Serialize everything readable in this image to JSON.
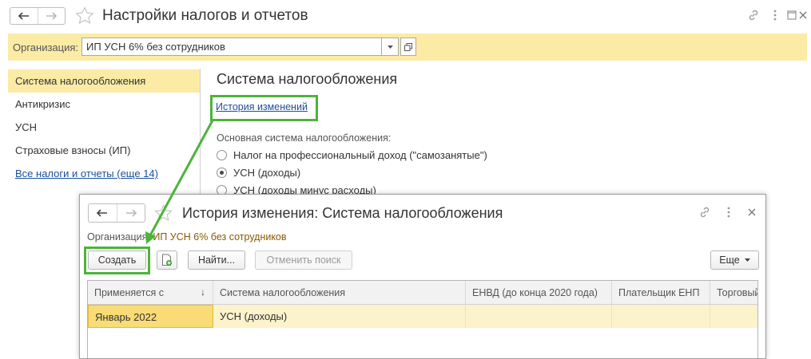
{
  "main_window": {
    "title": "Настройки налогов и отчетов",
    "organization_label": "Организация:",
    "organization_value": "ИП УСН 6% без сотрудников",
    "sidebar": [
      {
        "label": "Система налогообложения",
        "active": true,
        "link": false
      },
      {
        "label": "Антикризис",
        "active": false,
        "link": false
      },
      {
        "label": "УСН",
        "active": false,
        "link": false
      },
      {
        "label": "Страховые взносы (ИП)",
        "active": false,
        "link": false
      },
      {
        "label": "Все налоги и отчеты (еще 14)",
        "active": false,
        "link": true
      }
    ],
    "section_title": "Система налогообложения",
    "history_link": "История изменений",
    "main_tax_label": "Основная система налогообложения:",
    "tax_options": [
      {
        "label": "Налог на профессиональный доход (\"самозанятые\")",
        "checked": false
      },
      {
        "label": "УСН (доходы)",
        "checked": true
      },
      {
        "label": "УСН (доходы минус расходы)",
        "checked": false
      }
    ]
  },
  "popup": {
    "title": "История изменения: Система налогообложения",
    "organization_label": "Организация:",
    "organization_value": "ИП УСН 6% без сотрудников",
    "toolbar": {
      "create": "Создать",
      "find": "Найти...",
      "cancel_search": "Отменить поиск",
      "more": "Еще"
    },
    "columns": [
      "Применяется с",
      "Система налогообложения",
      "ЕНВД (до конца 2020 года)",
      "Плательщик ЕНП",
      "Торговый"
    ],
    "sort_indicator": "↓",
    "rows": [
      [
        "Январь 2022",
        "УСН (доходы)",
        "",
        "",
        ""
      ]
    ]
  },
  "colors": {
    "accent_yellow": "#fbeba5",
    "selected_row": "#fcf3cc",
    "current_cell": "#f9dc75",
    "highlight_green": "#4cb43a",
    "link_blue": "#1a4f9c"
  }
}
